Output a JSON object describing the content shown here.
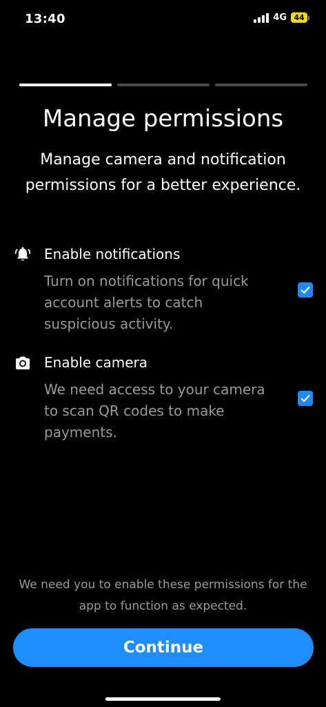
{
  "status_bar": {
    "time": "13:40",
    "network": "4G",
    "battery": "44"
  },
  "progress": {
    "total_steps": 3,
    "current_step": 1
  },
  "header": {
    "title": "Manage permissions",
    "subtitle": "Manage camera and notification permissions for a better experience."
  },
  "permissions": [
    {
      "icon": "bell-ringing-icon",
      "title": "Enable notifications",
      "description": "Turn on notifications for quick account alerts to catch suspicious activity.",
      "checked": true
    },
    {
      "icon": "camera-icon",
      "title": "Enable camera",
      "description": "We need access to your camera to scan QR codes to make payments.",
      "checked": true
    }
  ],
  "footer": {
    "note": "We need you to enable these permissions for the app to function as expected.",
    "continue_label": "Continue"
  },
  "colors": {
    "background": "#000000",
    "accent": "#1f8cff",
    "checkbox": "#1e88f5",
    "muted_text": "#9a9a9a",
    "battery": "#f5d90a"
  }
}
